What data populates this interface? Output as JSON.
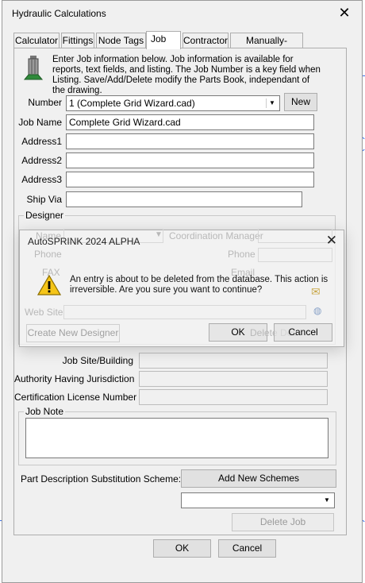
{
  "window": {
    "title": "Hydraulic Calculations",
    "tabs": [
      "Calculator",
      "Fittings",
      "Node Tags",
      "Job",
      "Contractor",
      "Manually-Flowing"
    ],
    "active_tab": "Job"
  },
  "job": {
    "info_text": "Enter Job information below. Job information is available for reports, text fields, and listing. The Job Number is a key field when Listing. Save/Add/Delete modify the Parts Book, independant of the drawing.",
    "number_label": "Number",
    "number_value": "1 (Complete Grid Wizard.cad)",
    "new_button": "New",
    "job_name_label": "Job Name",
    "job_name_value": "Complete Grid Wizard.cad",
    "address1_label": "Address1",
    "address2_label": "Address2",
    "address3_label": "Address3",
    "ship_via_label": "Ship Via",
    "designer_group_label": "Designer",
    "designer": {
      "name_label": "Name",
      "phone_label": "Phone",
      "fax_label": "FAX",
      "web_site_label": "Web Site",
      "coordination_manager_label": "Coordination Manager",
      "phone2_label": "Phone",
      "email_label": "Email",
      "create_button": "Create New Designer",
      "delete_button": "Delete Des"
    },
    "job_site_label": "Job Site/Building",
    "ahj_label": "Authority Having Jurisdiction",
    "cert_label": "Certification License Number",
    "job_note_label": "Job Note",
    "part_desc_label": "Part Description Substitution Scheme:",
    "add_schemes_button": "Add New Schemes",
    "delete_job_button": "Delete Job"
  },
  "footer": {
    "ok_button": "OK",
    "cancel_button": "Cancel"
  },
  "dialog": {
    "title": "AutoSPRINK 2024 ALPHA",
    "message": "An entry is about to be deleted from the database. This action is irreversible. Are you sure you want to continue?",
    "ok_button": "OK",
    "cancel_button": "Cancel"
  }
}
